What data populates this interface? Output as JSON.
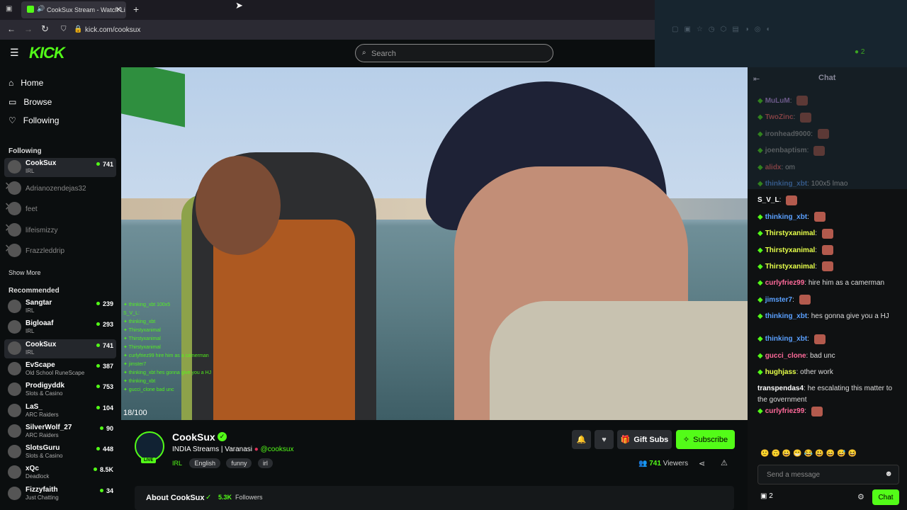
{
  "browser": {
    "tab_title": "CookSux Stream - Watch Li",
    "url": "kick.com/cooksux",
    "window_counter": "2"
  },
  "header": {
    "logo": "KICK",
    "search_placeholder": "Search"
  },
  "nav": {
    "home": "Home",
    "browse": "Browse",
    "following": "Following"
  },
  "following": {
    "title": "Following",
    "items": [
      {
        "name": "CookSux",
        "category": "IRL",
        "viewers": "741",
        "live": true
      },
      {
        "name": "Adrianozendejas32",
        "live": false
      },
      {
        "name": "feet",
        "live": false
      },
      {
        "name": "lifeismizzy",
        "live": false
      },
      {
        "name": "Frazzleddrip",
        "live": false
      }
    ],
    "show_more": "Show More"
  },
  "recommended": {
    "title": "Recommended",
    "items": [
      {
        "name": "Sangtar",
        "category": "IRL",
        "viewers": "239"
      },
      {
        "name": "Bigloaaf",
        "category": "IRL",
        "viewers": "293"
      },
      {
        "name": "CookSux",
        "category": "IRL",
        "viewers": "741"
      },
      {
        "name": "EvScape",
        "category": "Old School RuneScape",
        "viewers": "387"
      },
      {
        "name": "Prodigyddk",
        "category": "Slots & Casino",
        "viewers": "753"
      },
      {
        "name": "LaS_",
        "category": "ARC Raiders",
        "viewers": "104"
      },
      {
        "name": "SilverWolf_27",
        "category": "ARC Raiders",
        "viewers": "90"
      },
      {
        "name": "SlotsGuru",
        "category": "Slots & Casino",
        "viewers": "448"
      },
      {
        "name": "xQc",
        "category": "Deadlock",
        "viewers": "8.5K"
      },
      {
        "name": "Fizzyfaith",
        "category": "Just Chatting",
        "viewers": "34"
      }
    ]
  },
  "video": {
    "overlay_counter": "18/100"
  },
  "stream": {
    "channel": "CookSux",
    "title": "INDIA Streams | Varanasi",
    "handle": "@cooksux",
    "live_badge": "LIVE",
    "tags": [
      "IRL",
      "English",
      "funny",
      "irl"
    ],
    "viewers": "741",
    "viewers_label": "Viewers",
    "gift_subs": "Gift Subs",
    "subscribe": "Subscribe",
    "about": "About CookSux",
    "followers": "5.3K",
    "followers_label": "Followers"
  },
  "chat": {
    "title": "Chat",
    "input_placeholder": "Send a message",
    "chat_button": "Chat",
    "points": "2",
    "messages": [
      {
        "user": "MuLuM",
        "text": "",
        "color": "#d0a0ff"
      },
      {
        "user": "TwoZinc",
        "text": "",
        "color": "#ff6a6a"
      },
      {
        "user": "ironhead9000",
        "text": "",
        "color": "#aaaaaa"
      },
      {
        "user": "joenbaptism",
        "text": "",
        "color": "#aaaaaa"
      },
      {
        "user": "alidx",
        "text": "om",
        "color": "#ff6a6a"
      },
      {
        "user": "thinking_xbt",
        "text": "100x5 lmao",
        "color": "#5aa0ff"
      },
      {
        "user": "S_V_L",
        "text": "",
        "color": "#ffffff"
      },
      {
        "user": "thinking_xbt",
        "text": "",
        "color": "#5aa0ff"
      },
      {
        "user": "Thirstyxanimal",
        "text": "",
        "color": "#e6ff4a"
      },
      {
        "user": "Thirstyxanimal",
        "text": "",
        "color": "#e6ff4a"
      },
      {
        "user": "Thirstyxanimal",
        "text": "",
        "color": "#e6ff4a"
      },
      {
        "user": "curlyfriez99",
        "text": "hire him as a camerman",
        "color": "#ff6a9a"
      },
      {
        "user": "jimster7",
        "text": "",
        "color": "#5aa0ff"
      },
      {
        "user": "thinking_xbt",
        "text": "hes gonna give you a HJ",
        "color": "#5aa0ff"
      },
      {
        "user": "thinking_xbt",
        "text": "",
        "color": "#5aa0ff"
      },
      {
        "user": "gucci_clone",
        "text": "bad unc",
        "color": "#ff6a9a"
      },
      {
        "user": "hughjass",
        "text": "other work",
        "color": "#e6ff4a"
      },
      {
        "user": "transpendas4",
        "text": "he escalating this matter to the government",
        "color": "#ffffff"
      },
      {
        "user": "curlyfriez99",
        "text": "",
        "color": "#ff6a9a"
      }
    ]
  },
  "colors": {
    "accent": "#53fc18"
  }
}
